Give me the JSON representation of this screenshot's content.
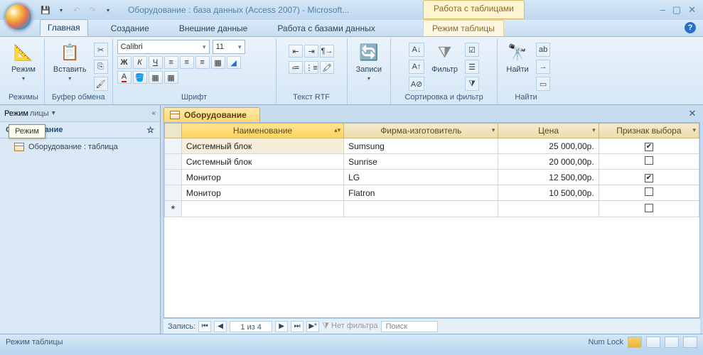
{
  "title": "Оборудование : база данных (Access 2007) - Microsoft...",
  "context_tab_group": "Работа с таблицами",
  "tabs": {
    "home": "Главная",
    "create": "Создание",
    "external": "Внешние данные",
    "dbtools": "Работа с базами данных",
    "datasheet": "Режим таблицы"
  },
  "ribbon": {
    "mode_btn": "Режим",
    "mode_group": "Режимы",
    "paste_btn": "Вставить",
    "clipboard_group": "Буфер обмена",
    "font_name": "Calibri",
    "font_size": "11",
    "font_group": "Шрифт",
    "rtf_group": "Текст RTF",
    "records_btn": "Записи",
    "filter_btn": "Фильтр",
    "sortfilter_group": "Сортировка и фильтр",
    "find_btn": "Найти",
    "find_group": "Найти"
  },
  "navpane": {
    "header": "Режим",
    "category": "Оборудование",
    "item": "Оборудование : таблица"
  },
  "tooltip": "Режим",
  "doc_tab": "Оборудование",
  "columns": {
    "name": "Наименование",
    "maker": "Фирма-изготовитель",
    "price": "Цена",
    "flag": "Признак выбора"
  },
  "rows": [
    {
      "name": "Системный блок",
      "maker": "Sumsung",
      "price": "25 000,00р.",
      "flag": true
    },
    {
      "name": "Системный блок",
      "maker": "Sunrise",
      "price": "20 000,00р.",
      "flag": false
    },
    {
      "name": "Монитор",
      "maker": "LG",
      "price": "12 500,00р.",
      "flag": true
    },
    {
      "name": "Монитор",
      "maker": "Flatron",
      "price": "10 500,00р.",
      "flag": false
    }
  ],
  "record_nav": {
    "label": "Запись:",
    "pos": "1 из 4",
    "nofilter": "Нет фильтра",
    "search": "Поиск"
  },
  "status": {
    "left": "Режим таблицы",
    "numlock": "Num Lock"
  },
  "truncated_text": "лицы"
}
